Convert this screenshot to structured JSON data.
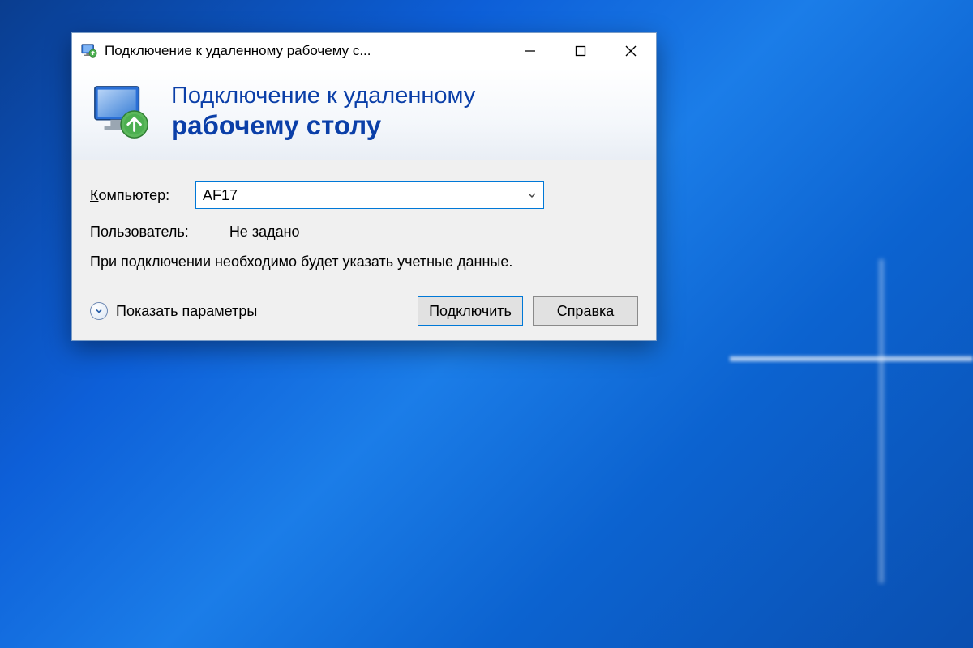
{
  "window": {
    "title": "Подключение к удаленному рабочему с..."
  },
  "banner": {
    "line1": "Подключение к удаленному",
    "line2": "рабочему столу"
  },
  "form": {
    "computer_label_prefix": "К",
    "computer_label_rest": "омпьютер:",
    "computer_value": "AF17",
    "user_label": "Пользователь:",
    "user_value": "Не задано",
    "hint": "При подключении необходимо будет указать учетные данные."
  },
  "footer": {
    "show_options": "Показать параметры",
    "connect_prefix": "П",
    "connect_rest": "одключить",
    "help_prefix": "С",
    "help_rest": "правка"
  }
}
